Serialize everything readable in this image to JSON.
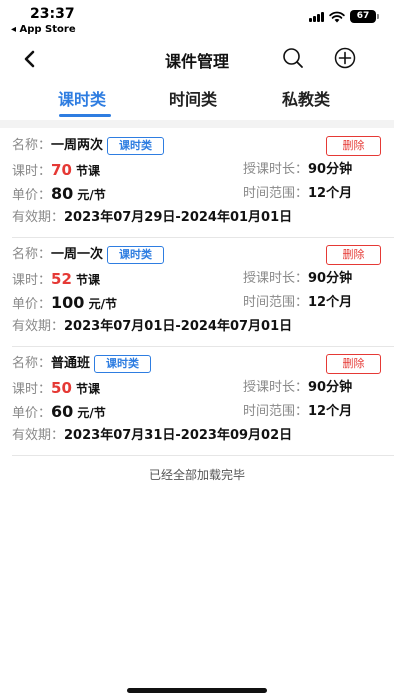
{
  "status_bar": {
    "time": "23:37",
    "back_app": "◂ App Store",
    "battery": "67"
  },
  "nav": {
    "title": "课件管理"
  },
  "tabs": [
    {
      "label": "课时类",
      "active": true
    },
    {
      "label": "时间类",
      "active": false
    },
    {
      "label": "私教类",
      "active": false
    }
  ],
  "labels": {
    "name": "名称：",
    "lessons": "课时：",
    "price": "单价：",
    "validity": "有效期：",
    "duration": "授课时长：",
    "range": "时间范围：",
    "delete": "删除",
    "lessons_unit": "节课",
    "price_unit": "元/节"
  },
  "courses": [
    {
      "name": "一周两次",
      "type": "课时类",
      "lessons": "70",
      "price": "80",
      "duration": "90分钟",
      "range": "12个月",
      "validity": "2023年07月29日-2024年01月01日"
    },
    {
      "name": "一周一次",
      "type": "课时类",
      "lessons": "52",
      "price": "100",
      "duration": "90分钟",
      "range": "12个月",
      "validity": "2023年07月01日-2024年07月01日"
    },
    {
      "name": "普通班",
      "type": "课时类",
      "lessons": "50",
      "price": "60",
      "duration": "90分钟",
      "range": "12个月",
      "validity": "2023年07月31日-2023年09月02日"
    }
  ],
  "footer": {
    "end_text": "已经全部加载完毕"
  },
  "icons": {
    "back": "chevron-left-icon",
    "search": "search-icon",
    "add": "plus-circle-icon"
  },
  "colors": {
    "accent": "#2e7de1",
    "danger": "#e53935"
  }
}
